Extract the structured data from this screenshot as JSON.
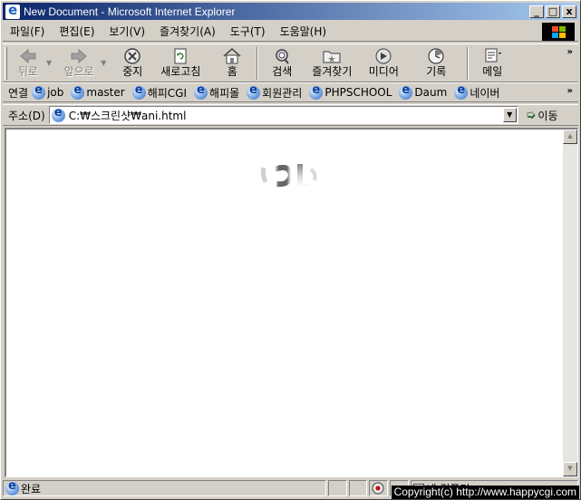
{
  "window": {
    "title": "New Document - Microsoft Internet Explorer",
    "buttons": {
      "minimize": "_",
      "maximize": "□",
      "close": "x"
    }
  },
  "menu": [
    "파일(F)",
    "편집(E)",
    "보기(V)",
    "즐겨찾기(A)",
    "도구(T)",
    "도움말(H)"
  ],
  "toolbar": {
    "back": "뒤로",
    "forward": "앞으로",
    "stop": "중지",
    "refresh": "새로고침",
    "home": "홈",
    "search": "검색",
    "favorites": "즐겨찾기",
    "media": "미디어",
    "history": "기록",
    "mail": "메일",
    "more": "»"
  },
  "links": {
    "label": "연결",
    "items": [
      "job",
      "master",
      "해피CGI",
      "해피몰",
      "회원관리",
      "PHPSCHOOL",
      "Daum",
      "네이버"
    ],
    "more": "»"
  },
  "address": {
    "label": "주소(D)",
    "value": "C:₩스크린샷₩ani.html",
    "go": "이동"
  },
  "status": {
    "text": "완료",
    "zone": "내 컴퓨터",
    "copyright": "Copyright(c) http://www.happycgi.com"
  },
  "colors": {
    "title_start": "#0a246a",
    "title_end": "#a6caf0",
    "chrome": "#d4d0c8"
  }
}
